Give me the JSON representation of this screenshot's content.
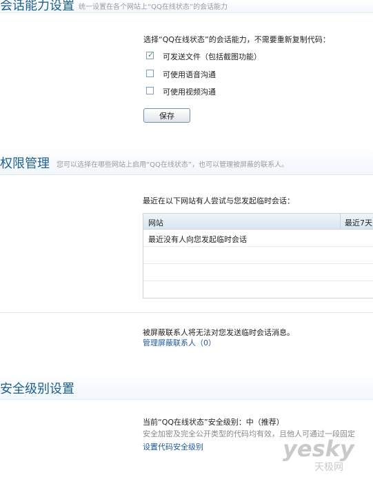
{
  "ability": {
    "title": "会话能力设置",
    "desc": "统一设置在各个网站上“QQ在线状态”的会话能力",
    "intro": "选择“QQ在线状态”的会话能力，不需要重新复制代码：",
    "options": [
      {
        "label": "可发送文件（包括截图功能）",
        "checked": true
      },
      {
        "label": "可使用语音沟通",
        "checked": false
      },
      {
        "label": "可使用视频沟通",
        "checked": false
      }
    ],
    "save_label": "保存"
  },
  "permission": {
    "title": "权限管理",
    "desc": "您可以选择在哪些网站上启用“QQ在线状态”，也可以管理被屏蔽的联系人。",
    "intro": "最近在以下网站有人尝试与您发起临时会话：",
    "table": {
      "col_site": "网站",
      "col_recent": "最近7天",
      "rows": [
        "最近没有人向您发起临时会话",
        "",
        "",
        ""
      ]
    },
    "blocked_note": "被屏蔽联系人将无法对您发送临时会话消息。",
    "blocked_link": "管理屏蔽联系人（0）"
  },
  "security": {
    "title": "安全级别设置",
    "current": "当前“QQ在线状态”安全级别：中（推荐）",
    "desc": "安全加密及完全公开类型的代码均有效，且他人可通过一段固定",
    "link": "设置代码安全级别"
  },
  "watermark": {
    "brand": "yesky",
    "sub": "天极网"
  },
  "colors": {
    "title": "#1b5f8e",
    "link": "#1f5aa0",
    "check": "#2a9b2a"
  }
}
